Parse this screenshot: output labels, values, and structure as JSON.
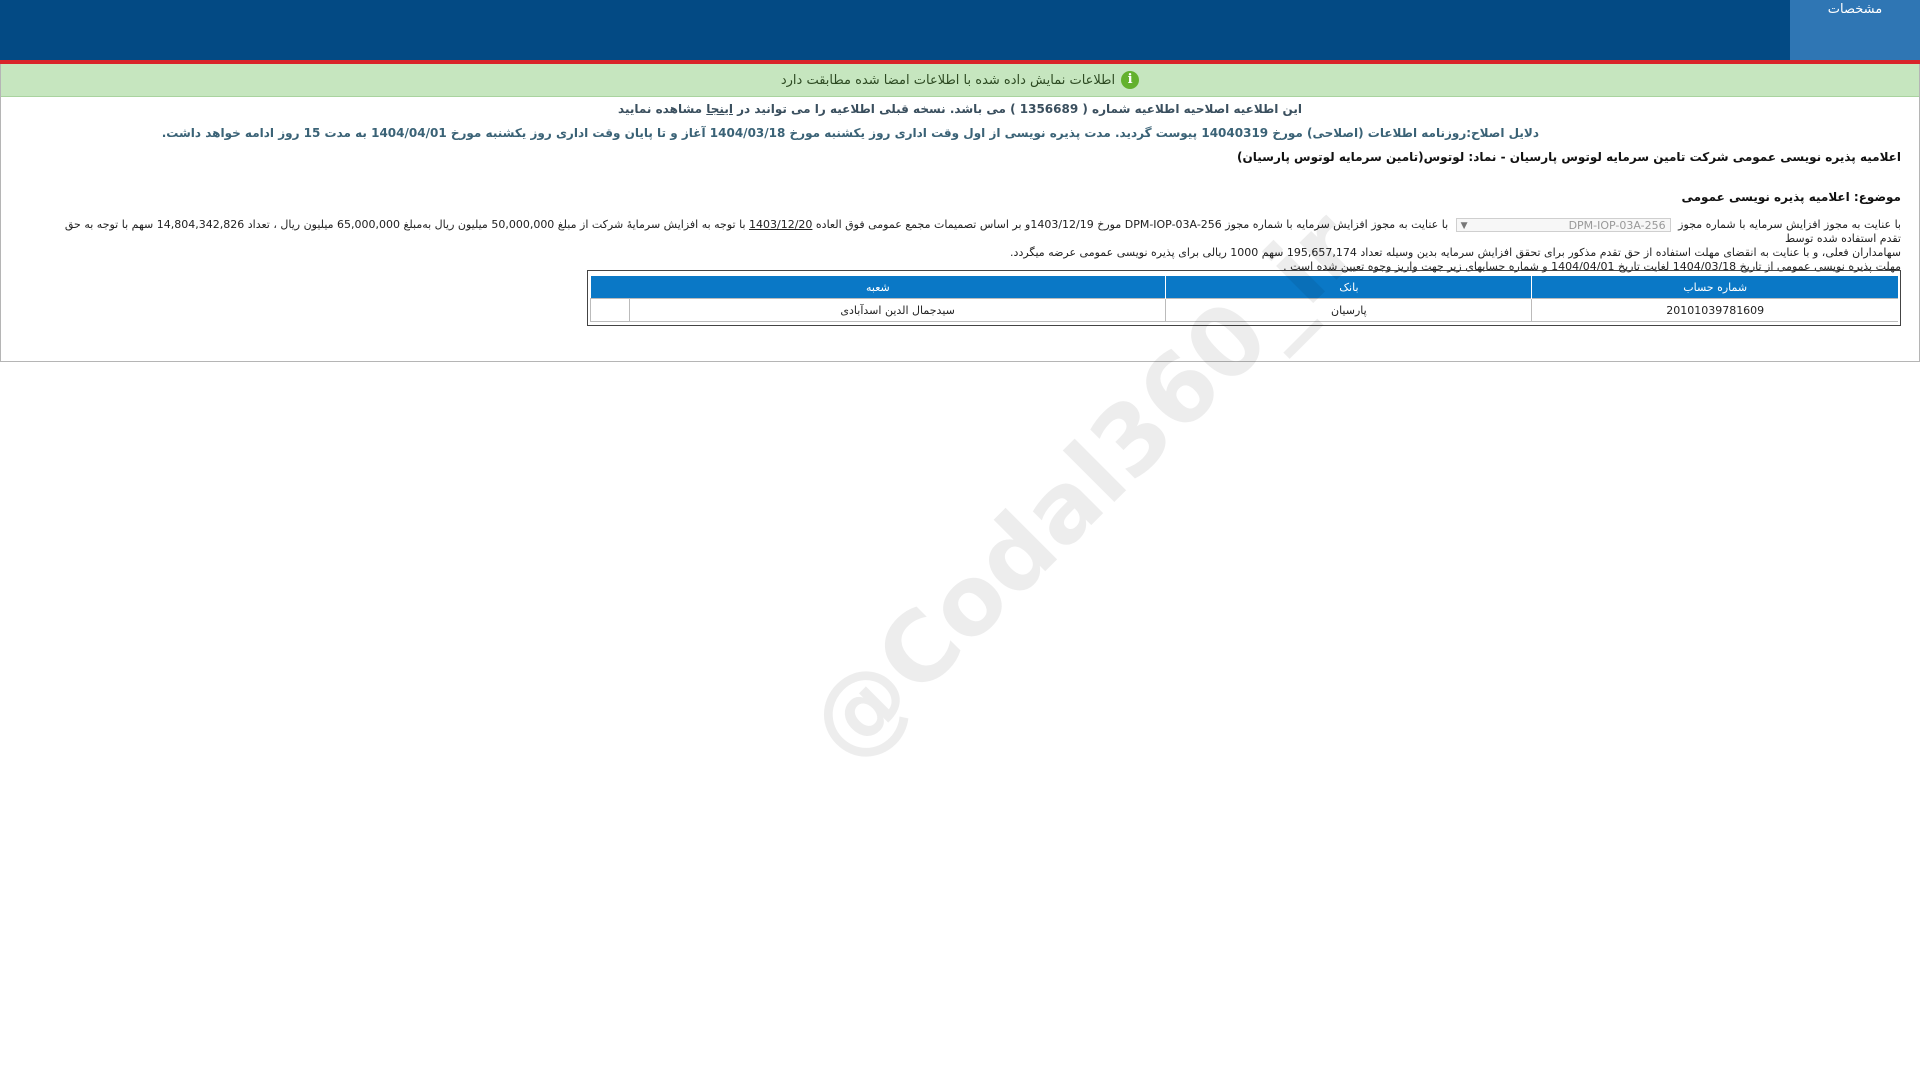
{
  "header": {
    "tab_label": "مشخصات"
  },
  "verify": {
    "message": "اطلاعات نمایش داده شده با اطلاعات امضا شده مطابقت دارد",
    "icon": "info-icon"
  },
  "notice": {
    "part1": "این اطلاعیه اصلاحیه اطلاعیه شماره ( 1356689 ) می باشد. نسخه قبلی اطلاعیه را می توانید در",
    "link": "اینجا",
    "part2": "مشاهده نمایید"
  },
  "reasons": "دلایل اصلاح:روزنامه اطلاعات (اصلاحی) مورخ 14040319 پیوست گردید. مدت پذیره نویسی از اول وقت اداری روز یکشنبه مورخ 1404/03/18 آغاز و تا پایان وقت اداری روز یکشنبه مورخ 1404/04/01 به مدت 15 روز ادامه خواهد داشت.",
  "title": "اعلامیه پذیره نویسی عمومی شرکت تامین سرمایه لوتوس پارسیان - نماد: لوتوس(تامین سرمایه لوتوس پارسیان)",
  "subject": "موضوع: اعلامیه پذیره نویسی عمومی",
  "body": {
    "l1_a": "با عنایت به مجوز افزایش سرمایه با شماره مجوز",
    "select_value": "DPM-IOP-03A-256",
    "l1_b": "با عنایت به مجوز افزایش سرمایه با شماره مجوز DPM-IOP-03A-256 مورخ 1403/12/19و بر اساس تصمیمات مجمع عمومی فوق العاده",
    "l1_date": "1403/12/20",
    "l1_c": "با توجه به افزایش سرمایهٔ شرکت از مبلغ 50,000,000 میلیون ریال به‌مبلغ 65,000,000 میلیون ریال ، تعداد 14,804,342,826 سهم با توجه به حق تقدم استفاده شده توسط",
    "l2": "سهامداران فعلی، و با عنایت به انقضای مهلت استفاده از حق تقدم مذکور برای تحقق افزایش سرمایه بدین وسیله تعداد 195,657,174 سهم 1000 ریالی برای پذیره نویسی عمومی عرضه میگردد.",
    "l3": "مهلت پذیره نویسی عمومی از تاریخ 1404/03/18 لغایت تاریخ 1404/04/01 و شماره حسابهای زیر جهت واریز وجوه تعیین شده است ."
  },
  "table": {
    "headers": [
      "شماره حساب",
      "بانک",
      "شعبه"
    ],
    "rows": [
      [
        "20101039781609",
        "پارسیان",
        "سیدجمال الدین اسدآبادی"
      ]
    ]
  },
  "watermark": "@Codal360_ir",
  "colors": {
    "topbar": "#034a84",
    "accent_red": "#d9242a",
    "verify_bg": "#c6e6bf",
    "table_header": "#0a78c6"
  }
}
